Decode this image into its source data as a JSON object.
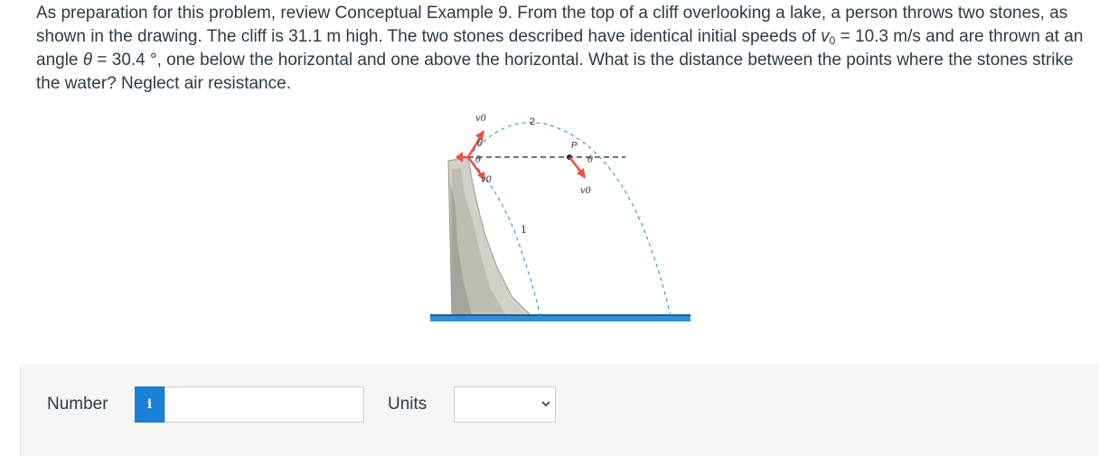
{
  "question": {
    "p1": "As preparation for this problem, review Conceptual Example 9. From the top of a cliff overlooking a lake, a person throws two stones, as shown in the drawing. The cliff is 31.1 m high. The two stones described have identical initial speeds of ",
    "v_symbol": "v",
    "v_sub": "0",
    "p2": " = 10.3 m/s and are thrown at an angle ",
    "theta_symbol": "θ",
    "p3": " = 30.4 °, one below the horizontal and one above the horizontal. What is the distance between the points where the stones strike the water? Neglect air resistance."
  },
  "figure": {
    "label_v0": "v0",
    "label_2": "2",
    "label_1": "1",
    "label_p": "P",
    "label_theta": "θ"
  },
  "answer": {
    "number_label": "Number",
    "info_icon": "i",
    "number_value": "",
    "units_label": "Units",
    "units_value": ""
  },
  "colors": {
    "arrow": "#e8523f",
    "water": "#2e8fdb",
    "info_badge": "#1a7fd6",
    "text": "#2d3b45"
  }
}
